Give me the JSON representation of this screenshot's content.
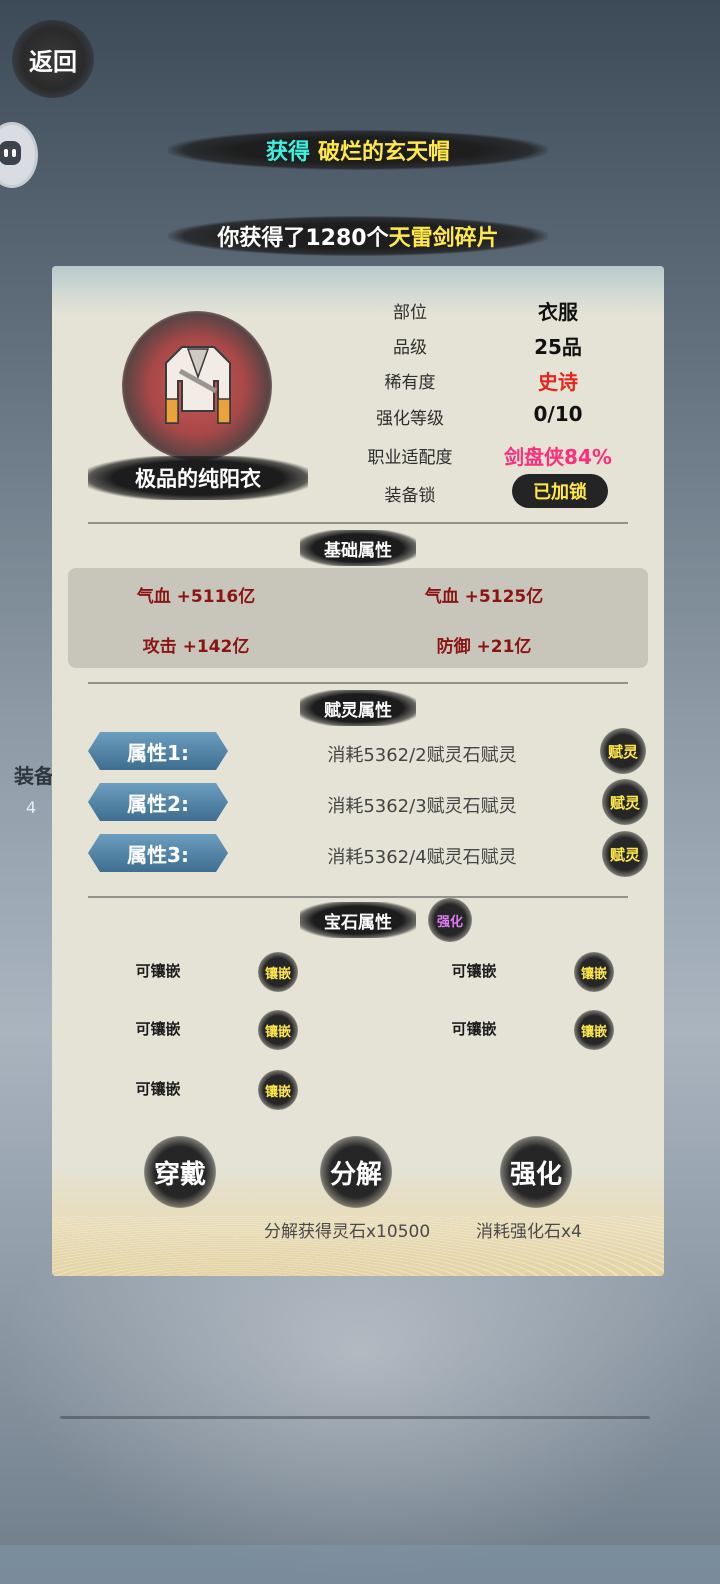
{
  "header": {
    "back_label": "返回"
  },
  "notices": {
    "obtain_prefix": "获得",
    "obtain_item": "破烂的玄天帽",
    "shards_prefix": "你获得了1280个",
    "shards_item": "天雷剑碎片"
  },
  "background_text": {
    "left_label": "装备",
    "left_number": "4"
  },
  "item": {
    "name": "极品的纯阳衣",
    "info": [
      {
        "label": "部位",
        "value": "衣服",
        "color": "#111111"
      },
      {
        "label": "品级",
        "value": "25品",
        "color": "#111111"
      },
      {
        "label": "稀有度",
        "value": "史诗",
        "color": "#e8241c"
      },
      {
        "label": "强化等级",
        "value": "0/10",
        "color": "#111111"
      },
      {
        "label": "职业适配度",
        "value": "剑盘侠84%",
        "color": "#ff2e7a"
      },
      {
        "label": "装备锁",
        "value": "已加锁",
        "color": "#ffe84a"
      }
    ]
  },
  "base_attributes": {
    "title": "基础属性",
    "stats": [
      "气血 +5116亿",
      "气血 +5125亿",
      "攻击 +142亿",
      "防御 +21亿"
    ]
  },
  "spirit_attributes": {
    "title": "赋灵属性",
    "rows": [
      {
        "label": "属性1:",
        "cost": "消耗5362/2赋灵石赋灵",
        "button": "赋灵"
      },
      {
        "label": "属性2:",
        "cost": "消耗5362/3赋灵石赋灵",
        "button": "赋灵"
      },
      {
        "label": "属性3:",
        "cost": "消耗5362/4赋灵石赋灵",
        "button": "赋灵"
      }
    ]
  },
  "gem_attributes": {
    "title": "宝石属性",
    "strengthen_label": "强化",
    "slot_label": "可镶嵌",
    "slot_button": "镶嵌"
  },
  "actions": {
    "wear": "穿戴",
    "decompose": "分解",
    "strengthen": "强化",
    "decompose_note": "分解获得灵石x10500",
    "strengthen_note": "消耗强化石x4"
  }
}
